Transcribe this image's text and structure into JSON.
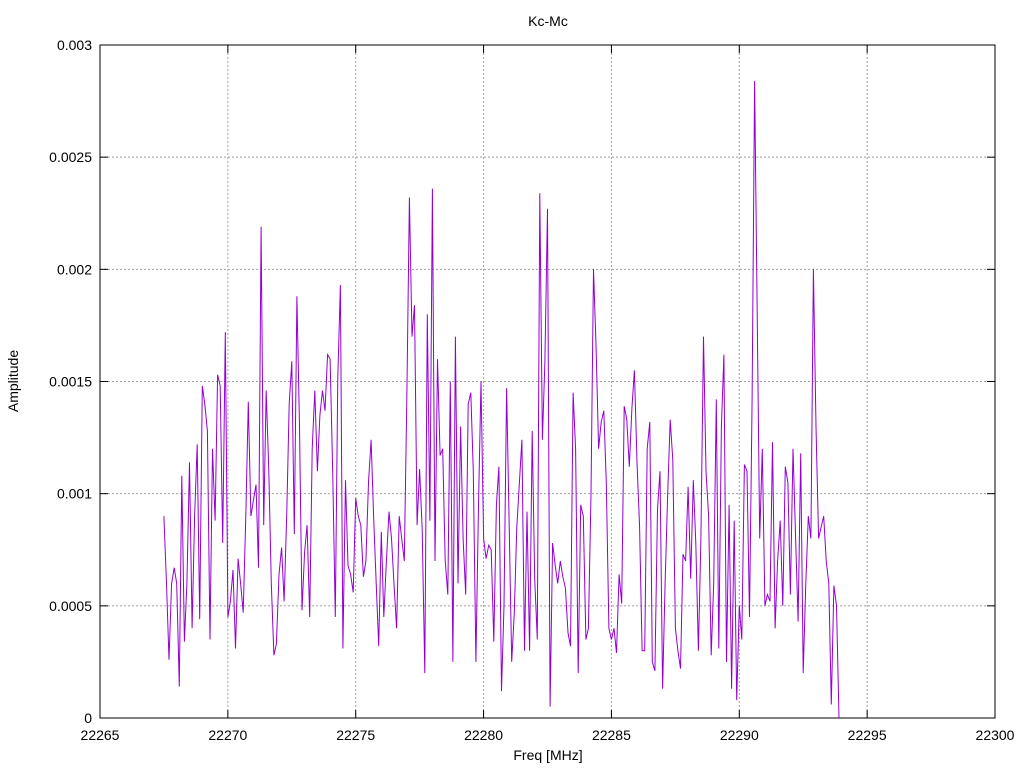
{
  "chart_data": {
    "type": "line",
    "title": "Kc-Mc",
    "xlabel": "Freq [MHz]",
    "ylabel": "Amplitude",
    "xlim": [
      22265,
      22300
    ],
    "ylim": [
      0,
      0.003
    ],
    "xticks": [
      22265,
      22270,
      22275,
      22280,
      22285,
      22290,
      22295,
      22300
    ],
    "xtick_labels": [
      "22265",
      "22270",
      "22275",
      "22280",
      "22285",
      "22290",
      "22295",
      "22300"
    ],
    "yticks": [
      0,
      0.0005,
      0.001,
      0.0015,
      0.002,
      0.0025,
      0.003
    ],
    "ytick_labels": [
      "0",
      "0.0005",
      "0.001",
      "0.0015",
      "0.002",
      "0.0025",
      "0.003"
    ],
    "grid": true,
    "line_color": "#9400d3",
    "series": [
      {
        "x_start": 22267.5,
        "x_step": 0.1,
        "values": [
          0.0009,
          0.0006,
          0.00026,
          0.0006,
          0.00067,
          0.0006,
          0.00014,
          0.00108,
          0.00034,
          0.0006,
          0.00114,
          0.0004,
          0.0009,
          0.00122,
          0.00044,
          0.00148,
          0.0014,
          0.00128,
          0.00035,
          0.0012,
          0.00088,
          0.00153,
          0.00148,
          0.00078,
          0.00172,
          0.00045,
          0.00052,
          0.00066,
          0.00031,
          0.00071,
          0.0006,
          0.00047,
          0.0009,
          0.00141,
          0.0009,
          0.00097,
          0.00104,
          0.00067,
          0.00219,
          0.00086,
          0.00146,
          0.0011,
          0.0006,
          0.00028,
          0.00033,
          0.00064,
          0.00076,
          0.00052,
          0.0009,
          0.0014,
          0.00159,
          0.00082,
          0.00188,
          0.0013,
          0.00048,
          0.00074,
          0.00086,
          0.00045,
          0.0012,
          0.00146,
          0.0011,
          0.00135,
          0.00146,
          0.00137,
          0.00162,
          0.0016,
          0.0011,
          0.00045,
          0.00152,
          0.00193,
          0.00031,
          0.00106,
          0.00068,
          0.00064,
          0.00056,
          0.00098,
          0.0009,
          0.00086,
          0.00063,
          0.0007,
          0.00105,
          0.00124,
          0.0009,
          0.0006,
          0.00032,
          0.00083,
          0.00045,
          0.0007,
          0.00092,
          0.0008,
          0.00059,
          0.0004,
          0.0009,
          0.0008,
          0.0007,
          0.00145,
          0.00232,
          0.0017,
          0.00184,
          0.00086,
          0.00111,
          0.00084,
          0.0002,
          0.0018,
          0.00088,
          0.00236,
          0.0007,
          0.0016,
          0.00117,
          0.0012,
          0.0007,
          0.00055,
          0.0015,
          0.00025,
          0.0017,
          0.0006,
          0.0013,
          0.0008,
          0.00055,
          0.0014,
          0.00145,
          0.0011,
          0.00025,
          0.00095,
          0.0015,
          0.0008,
          0.00071,
          0.00077,
          0.00075,
          0.00034,
          0.00095,
          0.00112,
          0.00012,
          0.0005,
          0.00147,
          0.00088,
          0.00025,
          0.00047,
          0.00085,
          0.00105,
          0.00124,
          0.0003,
          0.00092,
          0.0003,
          0.00128,
          0.00062,
          0.00035,
          0.00234,
          0.00124,
          0.00159,
          0.00227,
          5e-05,
          0.00078,
          0.00068,
          0.0006,
          0.0007,
          0.00063,
          0.00058,
          0.00038,
          0.00032,
          0.00145,
          0.0012,
          0.0002,
          0.00095,
          0.0009,
          0.00035,
          0.0004,
          0.001,
          0.002,
          0.00165,
          0.0012,
          0.00132,
          0.00137,
          0.00105,
          0.0004,
          0.00035,
          0.0004,
          0.00029,
          0.00064,
          0.00051,
          0.00139,
          0.00133,
          0.00112,
          0.00138,
          0.00155,
          0.00114,
          0.00085,
          0.0003,
          0.0003,
          0.0012,
          0.00132,
          0.00025,
          0.00021,
          0.00093,
          0.0011,
          0.00013,
          0.0006,
          0.001,
          0.00133,
          0.00115,
          0.0004,
          0.0003,
          0.00022,
          0.00073,
          0.0007,
          0.00103,
          0.00062,
          0.00106,
          0.00078,
          0.0003,
          0.0008,
          0.0017,
          0.0011,
          0.0009,
          0.00028,
          0.0006,
          0.00142,
          0.00031,
          0.0013,
          0.00162,
          0.00025,
          0.00095,
          0.00013,
          0.00088,
          8e-05,
          0.0005,
          0.00035,
          0.00113,
          0.0011,
          0.00045,
          0.00142,
          0.00284,
          0.0018,
          0.0008,
          0.0012,
          0.0005,
          0.00055,
          0.00052,
          0.00123,
          0.0004,
          0.0007,
          0.00088,
          0.0005,
          0.00112,
          0.00105,
          0.00055,
          0.0012,
          0.00082,
          0.00043,
          0.00118,
          0.0002,
          0.0006,
          0.0009,
          0.0008,
          0.002,
          0.0013,
          0.0008,
          0.00085,
          0.0009,
          0.0007,
          0.0006,
          6e-05,
          0.00059,
          0.0005,
          0.0
        ]
      }
    ]
  }
}
